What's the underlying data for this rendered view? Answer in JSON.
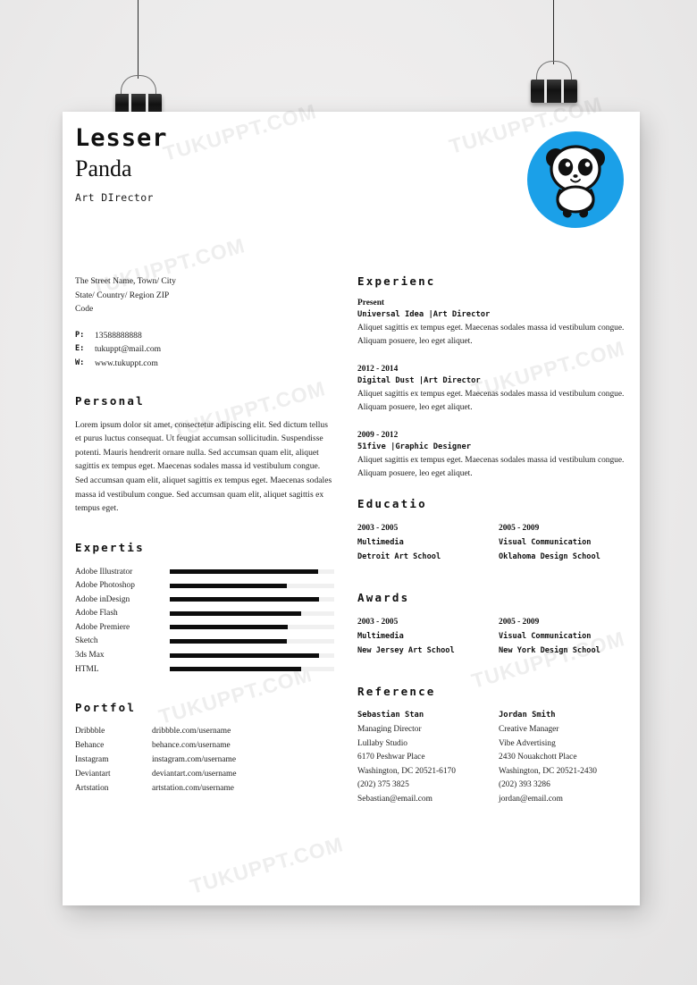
{
  "watermark": "TUKUPPT.COM",
  "theme": {
    "accent": "#1ba0e8",
    "bar_fill": "#0d0d0d",
    "bar_track": "#f0f0f0",
    "paper": "#ffffff"
  },
  "header": {
    "first_name": "Lesser",
    "last_name": "Panda",
    "job_title": "Art DIrector",
    "logo_name": "panda-logo"
  },
  "contact": {
    "address": [
      "The Street Name, Town/  City",
      "State/ Country/ Region ZIP",
      "Code"
    ],
    "lines": [
      {
        "key": "P:",
        "value": "13588888888"
      },
      {
        "key": "E:",
        "value": "tukuppt@mail.com"
      },
      {
        "key": "W:",
        "value": "www.tukuppt.com"
      }
    ]
  },
  "personal": {
    "title": "Personal",
    "text": "Lorem ipsum dolor sit amet, consectetur  adipiscing elit. Sed dictum tellus et purus luctus consequat.   Ut feugiat accumsan sollicitudin. Suspendisse  potenti. Mauris hendrerit ornare nulla. Sed accumsan  quam elit, aliquet sagittis ex tempus eget. Maecenas sodales massa id vestibulum congue. Sed accumsan  quam elit, aliquet sagittis ex tempus eget. Maecenas sodales massa id vestibulum congue. Sed accumsan  quam elit, aliquet sagittis ex tempus  eget."
  },
  "expertise": {
    "title": "Expertis",
    "skills": [
      {
        "name": "Adobe Illustrator",
        "level": 90
      },
      {
        "name": "Adobe Photoshop",
        "level": 71
      },
      {
        "name": "Adobe inDesign",
        "level": 91
      },
      {
        "name": "Adobe Flash",
        "level": 80
      },
      {
        "name": "Adobe Premiere",
        "level": 72
      },
      {
        "name": "Sketch",
        "level": 71
      },
      {
        "name": "3ds Max",
        "level": 91
      },
      {
        "name": "HTML",
        "level": 80
      }
    ]
  },
  "portfolio": {
    "title": "Portfol",
    "items": [
      {
        "name": "Dribbble",
        "url": "dribbble.com/username"
      },
      {
        "name": "Behance",
        "url": "behance.com/username"
      },
      {
        "name": "Instagram",
        "url": "instagram.com/username"
      },
      {
        "name": "Deviantart",
        "url": "deviantart.com/username"
      },
      {
        "name": "Artstation",
        "url": "artstation.com/username"
      }
    ]
  },
  "experience": {
    "title": "Experienc",
    "entries": [
      {
        "date": "Present",
        "org": "Universal Idea |Art Director",
        "desc": "Aliquet sagittis ex tempus eget. Maecenas sodales massa id vestibulum congue. Aliquam posuere, leo eget  aliquet."
      },
      {
        "date": "2012 - 2014",
        "org": "Digital Dust |Art Director",
        "desc": "Aliquet sagittis ex tempus eget. Maecenas sodales massa id vestibulum congue. Aliquam posuere, leo eget  aliquet."
      },
      {
        "date": "2009 - 2012",
        "org": "51five |Graphic Designer",
        "desc": "Aliquet sagittis ex tempus eget. Maecenas sodales massa id vestibulum congue. Aliquam posuere, leo eget  aliquet."
      }
    ]
  },
  "education": {
    "title": "Educatio",
    "entries": [
      {
        "date": "2003 - 2005",
        "field": "Multimedia",
        "school": "Detroit Art School"
      },
      {
        "date": "2005 - 2009",
        "field": "Visual Communication",
        "school": "Oklahoma Design School"
      }
    ]
  },
  "awards": {
    "title": "Awards",
    "entries": [
      {
        "date": "2003 - 2005",
        "field": "Multimedia",
        "school": "New Jersey Art School"
      },
      {
        "date": "2005 - 2009",
        "field": "Visual Communication",
        "school": "New York Design School"
      }
    ]
  },
  "reference": {
    "title": "Reference",
    "entries": [
      {
        "name": "Sebastian Stan",
        "role": "Managing Director",
        "company": "Lullaby Studio",
        "street": "6170 Peshwar Place",
        "city": "Washington, DC 20521-6170",
        "phone": "(202) 375 3825",
        "email": "Sebastian@email.com"
      },
      {
        "name": "Jordan Smith",
        "role": "Creative Manager",
        "company": "Vibe Advertising",
        "street": "2430 Nouakchott Place",
        "city": "Washington, DC 20521-2430",
        "phone": "(202) 393 3286",
        "email": "jordan@email.com"
      }
    ]
  }
}
